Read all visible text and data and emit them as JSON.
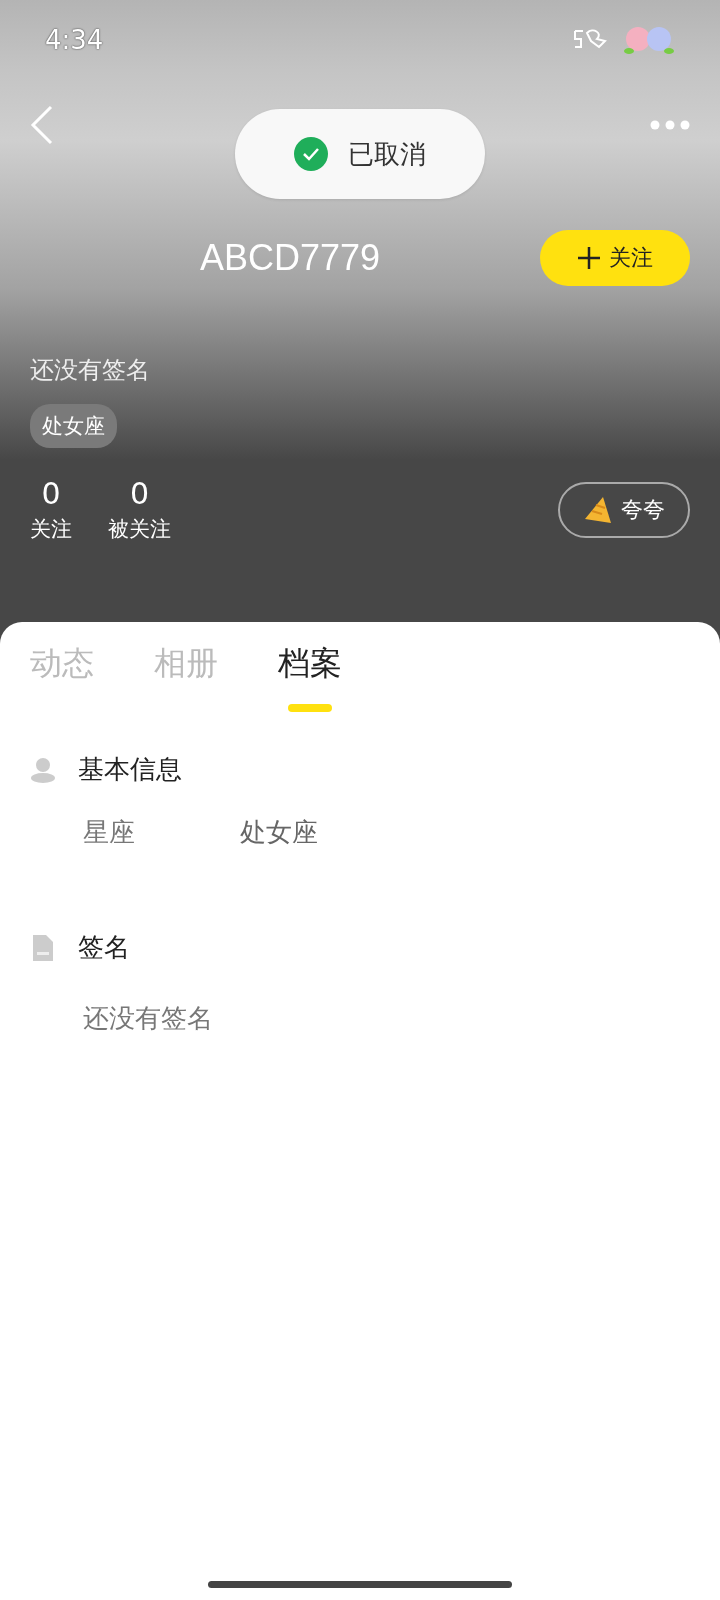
{
  "status_bar": {
    "time": "4:34"
  },
  "toast": {
    "text": "已取消"
  },
  "profile": {
    "name": "ABCD7779",
    "follow_button": "关注",
    "signature": "还没有签名",
    "tags": [
      "处女座"
    ],
    "stats": [
      {
        "value": "0",
        "label": "关注"
      },
      {
        "value": "0",
        "label": "被关注"
      }
    ],
    "praise_button": "夸夸"
  },
  "tabs": [
    {
      "label": "动态",
      "selected": false
    },
    {
      "label": "相册",
      "selected": false
    },
    {
      "label": "档案",
      "selected": true
    }
  ],
  "sections": [
    {
      "kind": "info",
      "title": "基本信息",
      "rows": [
        {
          "label": "星座",
          "value": "处女座"
        }
      ]
    },
    {
      "kind": "text",
      "title": "签名",
      "text": "还没有签名"
    }
  ]
}
